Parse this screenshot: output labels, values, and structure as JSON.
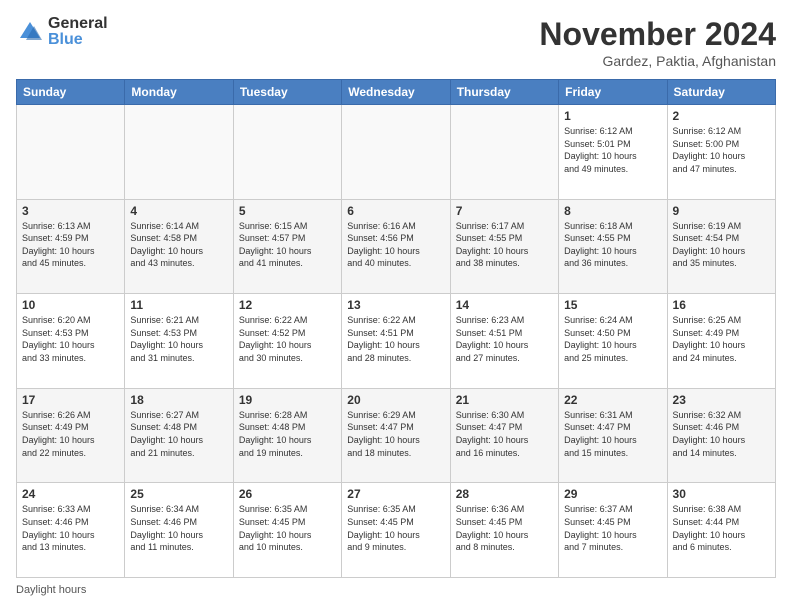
{
  "header": {
    "logo_general": "General",
    "logo_blue": "Blue",
    "month_title": "November 2024",
    "location": "Gardez, Paktia, Afghanistan"
  },
  "days_of_week": [
    "Sunday",
    "Monday",
    "Tuesday",
    "Wednesday",
    "Thursday",
    "Friday",
    "Saturday"
  ],
  "weeks": [
    [
      {
        "day": "",
        "info": ""
      },
      {
        "day": "",
        "info": ""
      },
      {
        "day": "",
        "info": ""
      },
      {
        "day": "",
        "info": ""
      },
      {
        "day": "",
        "info": ""
      },
      {
        "day": "1",
        "info": "Sunrise: 6:12 AM\nSunset: 5:01 PM\nDaylight: 10 hours\nand 49 minutes."
      },
      {
        "day": "2",
        "info": "Sunrise: 6:12 AM\nSunset: 5:00 PM\nDaylight: 10 hours\nand 47 minutes."
      }
    ],
    [
      {
        "day": "3",
        "info": "Sunrise: 6:13 AM\nSunset: 4:59 PM\nDaylight: 10 hours\nand 45 minutes."
      },
      {
        "day": "4",
        "info": "Sunrise: 6:14 AM\nSunset: 4:58 PM\nDaylight: 10 hours\nand 43 minutes."
      },
      {
        "day": "5",
        "info": "Sunrise: 6:15 AM\nSunset: 4:57 PM\nDaylight: 10 hours\nand 41 minutes."
      },
      {
        "day": "6",
        "info": "Sunrise: 6:16 AM\nSunset: 4:56 PM\nDaylight: 10 hours\nand 40 minutes."
      },
      {
        "day": "7",
        "info": "Sunrise: 6:17 AM\nSunset: 4:55 PM\nDaylight: 10 hours\nand 38 minutes."
      },
      {
        "day": "8",
        "info": "Sunrise: 6:18 AM\nSunset: 4:55 PM\nDaylight: 10 hours\nand 36 minutes."
      },
      {
        "day": "9",
        "info": "Sunrise: 6:19 AM\nSunset: 4:54 PM\nDaylight: 10 hours\nand 35 minutes."
      }
    ],
    [
      {
        "day": "10",
        "info": "Sunrise: 6:20 AM\nSunset: 4:53 PM\nDaylight: 10 hours\nand 33 minutes."
      },
      {
        "day": "11",
        "info": "Sunrise: 6:21 AM\nSunset: 4:53 PM\nDaylight: 10 hours\nand 31 minutes."
      },
      {
        "day": "12",
        "info": "Sunrise: 6:22 AM\nSunset: 4:52 PM\nDaylight: 10 hours\nand 30 minutes."
      },
      {
        "day": "13",
        "info": "Sunrise: 6:22 AM\nSunset: 4:51 PM\nDaylight: 10 hours\nand 28 minutes."
      },
      {
        "day": "14",
        "info": "Sunrise: 6:23 AM\nSunset: 4:51 PM\nDaylight: 10 hours\nand 27 minutes."
      },
      {
        "day": "15",
        "info": "Sunrise: 6:24 AM\nSunset: 4:50 PM\nDaylight: 10 hours\nand 25 minutes."
      },
      {
        "day": "16",
        "info": "Sunrise: 6:25 AM\nSunset: 4:49 PM\nDaylight: 10 hours\nand 24 minutes."
      }
    ],
    [
      {
        "day": "17",
        "info": "Sunrise: 6:26 AM\nSunset: 4:49 PM\nDaylight: 10 hours\nand 22 minutes."
      },
      {
        "day": "18",
        "info": "Sunrise: 6:27 AM\nSunset: 4:48 PM\nDaylight: 10 hours\nand 21 minutes."
      },
      {
        "day": "19",
        "info": "Sunrise: 6:28 AM\nSunset: 4:48 PM\nDaylight: 10 hours\nand 19 minutes."
      },
      {
        "day": "20",
        "info": "Sunrise: 6:29 AM\nSunset: 4:47 PM\nDaylight: 10 hours\nand 18 minutes."
      },
      {
        "day": "21",
        "info": "Sunrise: 6:30 AM\nSunset: 4:47 PM\nDaylight: 10 hours\nand 16 minutes."
      },
      {
        "day": "22",
        "info": "Sunrise: 6:31 AM\nSunset: 4:47 PM\nDaylight: 10 hours\nand 15 minutes."
      },
      {
        "day": "23",
        "info": "Sunrise: 6:32 AM\nSunset: 4:46 PM\nDaylight: 10 hours\nand 14 minutes."
      }
    ],
    [
      {
        "day": "24",
        "info": "Sunrise: 6:33 AM\nSunset: 4:46 PM\nDaylight: 10 hours\nand 13 minutes."
      },
      {
        "day": "25",
        "info": "Sunrise: 6:34 AM\nSunset: 4:46 PM\nDaylight: 10 hours\nand 11 minutes."
      },
      {
        "day": "26",
        "info": "Sunrise: 6:35 AM\nSunset: 4:45 PM\nDaylight: 10 hours\nand 10 minutes."
      },
      {
        "day": "27",
        "info": "Sunrise: 6:35 AM\nSunset: 4:45 PM\nDaylight: 10 hours\nand 9 minutes."
      },
      {
        "day": "28",
        "info": "Sunrise: 6:36 AM\nSunset: 4:45 PM\nDaylight: 10 hours\nand 8 minutes."
      },
      {
        "day": "29",
        "info": "Sunrise: 6:37 AM\nSunset: 4:45 PM\nDaylight: 10 hours\nand 7 minutes."
      },
      {
        "day": "30",
        "info": "Sunrise: 6:38 AM\nSunset: 4:44 PM\nDaylight: 10 hours\nand 6 minutes."
      }
    ]
  ],
  "footer": {
    "note": "Daylight hours"
  }
}
